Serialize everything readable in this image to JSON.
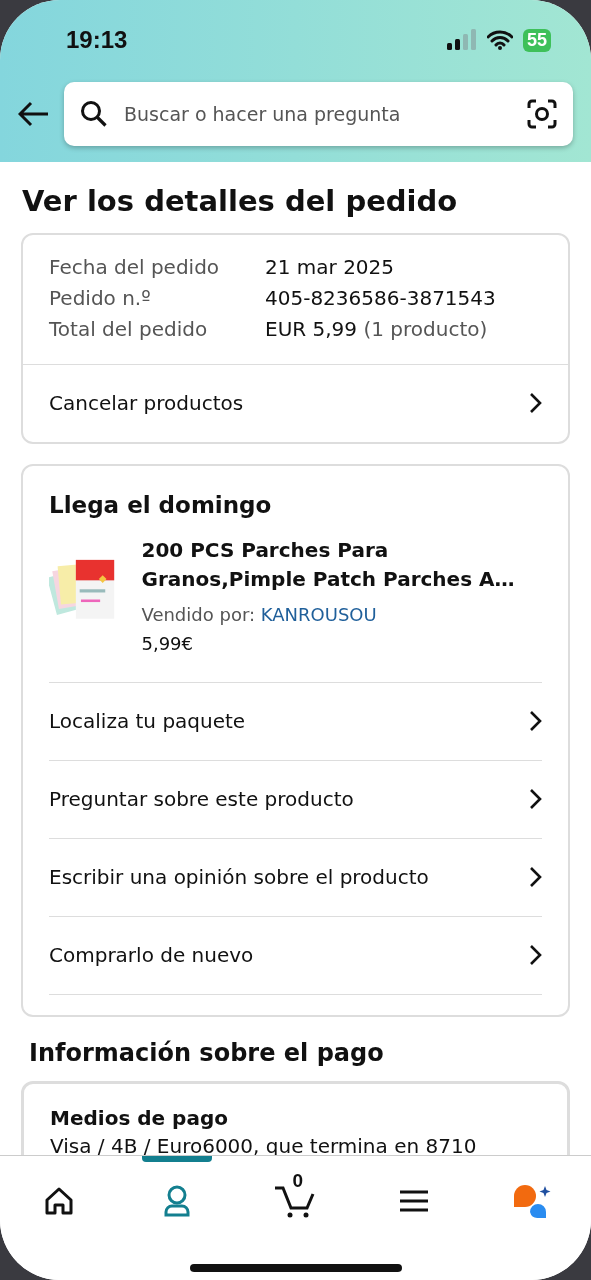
{
  "status_bar": {
    "time": "19:13",
    "battery": "55"
  },
  "search": {
    "placeholder": "Buscar o hacer una pregunta"
  },
  "title": "Ver los detalles del pedido",
  "order_summary": {
    "rows": [
      {
        "label": "Fecha del pedido",
        "value": "21 mar 2025"
      },
      {
        "label": "Pedido n.º",
        "value": "405-8236586-3871543"
      },
      {
        "label": "Total del pedido",
        "value": "EUR 5,99",
        "note": "(1 producto)"
      }
    ],
    "action": "Cancelar productos"
  },
  "shipment": {
    "heading": "Llega el domingo",
    "product": {
      "title": "200 PCS Parches Para Granos,Pimple Patch Parches A…",
      "seller_label": "Vendido por:",
      "seller": "KANROUSOU",
      "price": "5,99€"
    },
    "actions": [
      "Localiza tu paquete",
      "Preguntar sobre este producto",
      "Escribir una opinión sobre el producto",
      "Comprarlo de nuevo"
    ]
  },
  "payment": {
    "heading": "Información sobre el pago",
    "card_title": "Medios de pago",
    "method": "Visa / 4B / Euro6000, que termina en 8710"
  },
  "bottom_nav": [
    {
      "kind": "home",
      "selected": false
    },
    {
      "kind": "account",
      "selected": true
    },
    {
      "kind": "cart",
      "count": "0",
      "selected": false
    },
    {
      "kind": "menu",
      "selected": false
    },
    {
      "kind": "assistant",
      "selected": false
    }
  ]
}
